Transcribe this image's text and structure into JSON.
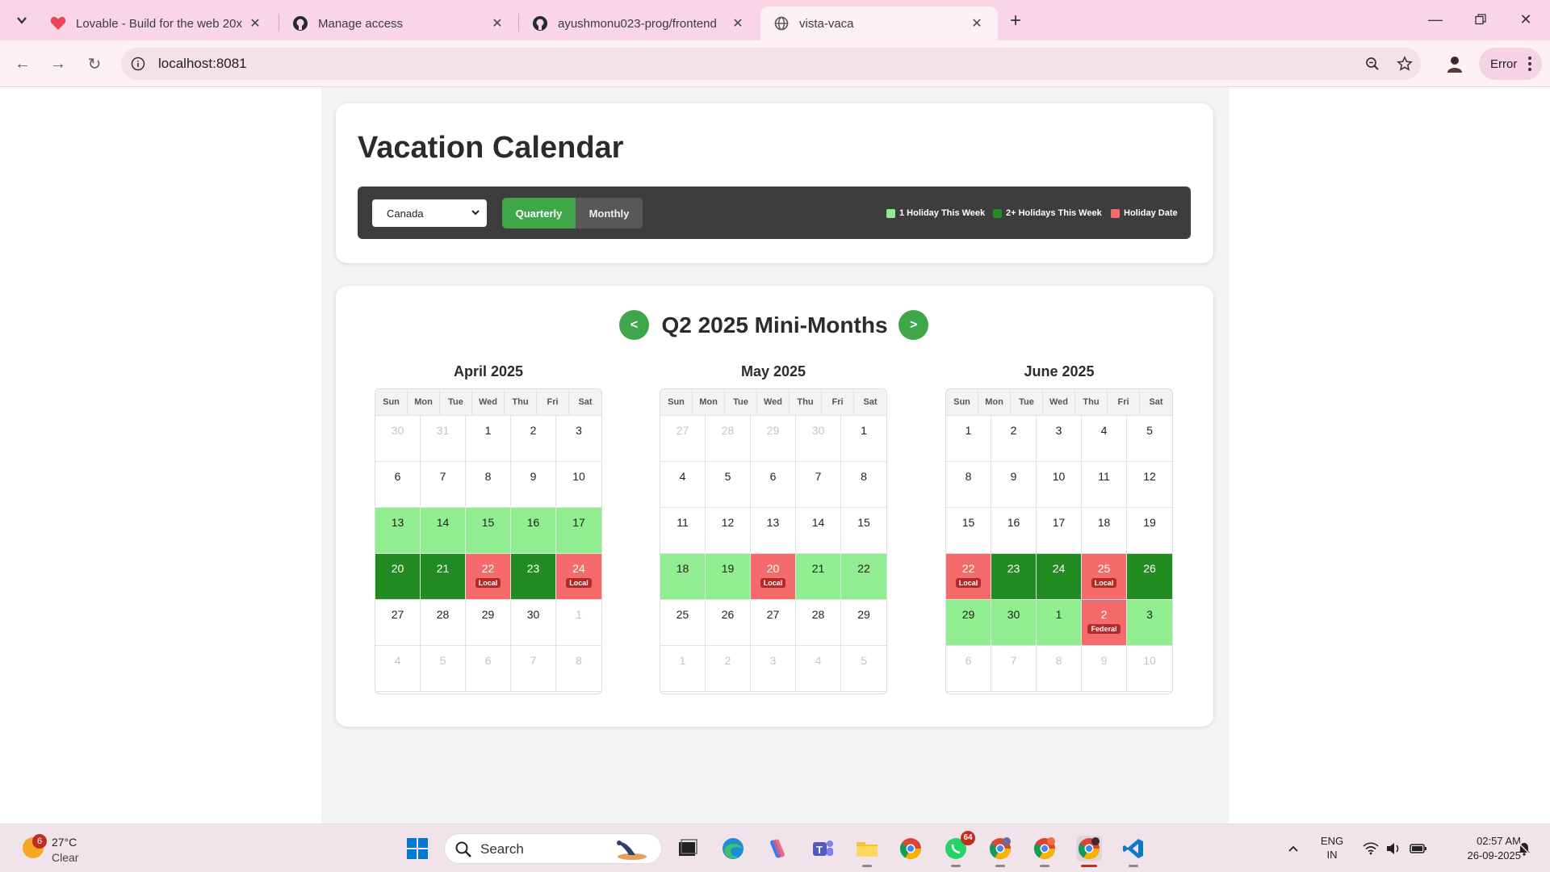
{
  "browser": {
    "tabs": [
      {
        "title": "Lovable - Build for the web 20x",
        "icon": "lovable-heart-icon",
        "active": false
      },
      {
        "title": "Manage access",
        "icon": "github-icon",
        "active": false
      },
      {
        "title": "ayushmonu023-prog/frontend",
        "icon": "github-icon",
        "active": false
      },
      {
        "title": "vista-vaca",
        "icon": "globe-icon",
        "active": true
      }
    ],
    "url": "localhost:8081",
    "error_label": "Error"
  },
  "app": {
    "title": "Vacation Calendar",
    "country": "Canada",
    "view_quarterly": "Quarterly",
    "view_monthly": "Monthly",
    "active_view": "Quarterly",
    "legend": [
      {
        "label": "1 Holiday This Week",
        "color": "#90ee90"
      },
      {
        "label": "2+ Holidays This Week",
        "color": "#228b22"
      },
      {
        "label": "Holiday Date",
        "color": "#f56b6b"
      }
    ],
    "prev_label": "<",
    "next_label": ">",
    "quarter_title": "Q2 2025 Mini-Months",
    "weekdays": [
      "Sun",
      "Mon",
      "Tue",
      "Wed",
      "Thu",
      "Fri",
      "Sat"
    ],
    "months": [
      {
        "title": "April 2025",
        "weeks": [
          [
            {
              "d": "30",
              "s": "muted"
            },
            {
              "d": "31",
              "s": "muted"
            },
            {
              "d": "1"
            },
            {
              "d": "2"
            },
            {
              "d": "3"
            }
          ],
          [
            {
              "d": "6"
            },
            {
              "d": "7"
            },
            {
              "d": "8"
            },
            {
              "d": "9"
            },
            {
              "d": "10"
            }
          ],
          [
            {
              "d": "13",
              "s": "light"
            },
            {
              "d": "14",
              "s": "light"
            },
            {
              "d": "15",
              "s": "light"
            },
            {
              "d": "16",
              "s": "light"
            },
            {
              "d": "17",
              "s": "light"
            }
          ],
          [
            {
              "d": "20",
              "s": "dark"
            },
            {
              "d": "21",
              "s": "dark"
            },
            {
              "d": "22",
              "s": "holiday",
              "badge": "Local"
            },
            {
              "d": "23",
              "s": "dark"
            },
            {
              "d": "24",
              "s": "holiday",
              "badge": "Local"
            }
          ],
          [
            {
              "d": "27"
            },
            {
              "d": "28"
            },
            {
              "d": "29"
            },
            {
              "d": "30"
            },
            {
              "d": "1",
              "s": "muted"
            }
          ],
          [
            {
              "d": "4",
              "s": "muted"
            },
            {
              "d": "5",
              "s": "muted"
            },
            {
              "d": "6",
              "s": "muted"
            },
            {
              "d": "7",
              "s": "muted"
            },
            {
              "d": "8",
              "s": "muted"
            }
          ]
        ]
      },
      {
        "title": "May 2025",
        "weeks": [
          [
            {
              "d": "27",
              "s": "muted"
            },
            {
              "d": "28",
              "s": "muted"
            },
            {
              "d": "29",
              "s": "muted"
            },
            {
              "d": "30",
              "s": "muted"
            },
            {
              "d": "1"
            }
          ],
          [
            {
              "d": "4"
            },
            {
              "d": "5"
            },
            {
              "d": "6"
            },
            {
              "d": "7"
            },
            {
              "d": "8"
            }
          ],
          [
            {
              "d": "11"
            },
            {
              "d": "12"
            },
            {
              "d": "13"
            },
            {
              "d": "14"
            },
            {
              "d": "15"
            }
          ],
          [
            {
              "d": "18",
              "s": "light"
            },
            {
              "d": "19",
              "s": "light"
            },
            {
              "d": "20",
              "s": "holiday",
              "badge": "Local"
            },
            {
              "d": "21",
              "s": "light"
            },
            {
              "d": "22",
              "s": "light"
            }
          ],
          [
            {
              "d": "25"
            },
            {
              "d": "26"
            },
            {
              "d": "27"
            },
            {
              "d": "28"
            },
            {
              "d": "29"
            }
          ],
          [
            {
              "d": "1",
              "s": "muted"
            },
            {
              "d": "2",
              "s": "muted"
            },
            {
              "d": "3",
              "s": "muted"
            },
            {
              "d": "4",
              "s": "muted"
            },
            {
              "d": "5",
              "s": "muted"
            }
          ]
        ]
      },
      {
        "title": "June 2025",
        "weeks": [
          [
            {
              "d": "1"
            },
            {
              "d": "2"
            },
            {
              "d": "3"
            },
            {
              "d": "4"
            },
            {
              "d": "5"
            }
          ],
          [
            {
              "d": "8"
            },
            {
              "d": "9"
            },
            {
              "d": "10"
            },
            {
              "d": "11"
            },
            {
              "d": "12"
            }
          ],
          [
            {
              "d": "15"
            },
            {
              "d": "16"
            },
            {
              "d": "17"
            },
            {
              "d": "18"
            },
            {
              "d": "19"
            }
          ],
          [
            {
              "d": "22",
              "s": "holiday",
              "badge": "Local"
            },
            {
              "d": "23",
              "s": "dark"
            },
            {
              "d": "24",
              "s": "dark"
            },
            {
              "d": "25",
              "s": "holiday",
              "badge": "Local"
            },
            {
              "d": "26",
              "s": "dark"
            }
          ],
          [
            {
              "d": "29",
              "s": "light"
            },
            {
              "d": "30",
              "s": "light"
            },
            {
              "d": "1",
              "s": "light"
            },
            {
              "d": "2",
              "s": "holiday",
              "badge": "Federal"
            },
            {
              "d": "3",
              "s": "light"
            }
          ],
          [
            {
              "d": "6",
              "s": "muted"
            },
            {
              "d": "7",
              "s": "muted"
            },
            {
              "d": "8",
              "s": "muted"
            },
            {
              "d": "9",
              "s": "muted"
            },
            {
              "d": "10",
              "s": "muted"
            }
          ]
        ]
      }
    ]
  },
  "taskbar": {
    "weather_badge": "6",
    "temperature": "27°C",
    "condition": "Clear",
    "search_label": "Search",
    "whatsapp_badge": "64",
    "lang_line1": "ENG",
    "lang_line2": "IN",
    "time": "02:57 AM",
    "date": "26-09-2025"
  }
}
